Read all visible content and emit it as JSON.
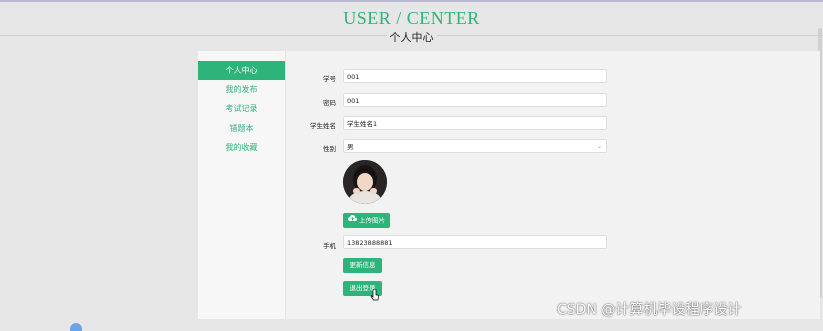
{
  "header": {
    "title": "USER / CENTER",
    "subtitle": "个人中心"
  },
  "sidebar": {
    "items": [
      {
        "label": "个人中心",
        "active": true
      },
      {
        "label": "我的发布",
        "active": false
      },
      {
        "label": "考试记录",
        "active": false
      },
      {
        "label": "错题本",
        "active": false
      },
      {
        "label": "我的收藏",
        "active": false
      }
    ]
  },
  "form": {
    "student_id": {
      "label": "学号",
      "value": "001"
    },
    "password": {
      "label": "密码",
      "value": "001"
    },
    "student_name": {
      "label": "学生姓名",
      "value": "学生姓名1"
    },
    "gender": {
      "label": "性别",
      "value": "男"
    },
    "upload_label": "上传图片",
    "phone": {
      "label": "手机",
      "value": "13823888881"
    },
    "update_label": "更新信息",
    "logout_label": "退出登录"
  },
  "watermark": "CSDN @计算机毕设程序设计",
  "colors": {
    "accent": "#2db47a",
    "background": "#e6e6e6"
  }
}
